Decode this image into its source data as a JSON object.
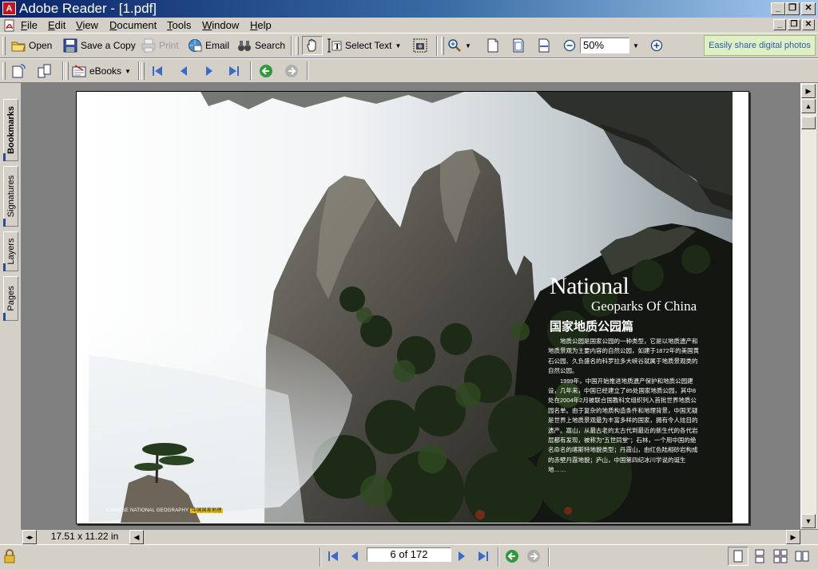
{
  "window": {
    "title": "Adobe Reader - [1.pdf]",
    "app_icon_glyph": "A"
  },
  "menu": [
    {
      "label": "File",
      "access": "F"
    },
    {
      "label": "Edit",
      "access": "E"
    },
    {
      "label": "View",
      "access": "V"
    },
    {
      "label": "Document",
      "access": "D"
    },
    {
      "label": "Tools",
      "access": "T"
    },
    {
      "label": "Window",
      "access": "W"
    },
    {
      "label": "Help",
      "access": "H"
    }
  ],
  "toolbar": {
    "open": "Open",
    "save_copy": "Save a Copy",
    "print": "Print",
    "email": "Email",
    "search": "Search",
    "select_text": "Select Text",
    "zoom": "50%",
    "promo": "Easily share digital photos",
    "ebooks": "eBooks"
  },
  "nav_tabs": [
    "Bookmarks",
    "Signatures",
    "Layers",
    "Pages"
  ],
  "document": {
    "title_en_1": "National",
    "title_en_2": "Geoparks Of China",
    "title_cn": "国家地质公园篇",
    "paragraphs": [
      "　　地质公园是国家公园的一种类型，它是以地质遗产和地质景观为主要内容的自然公园，如建于1872年的美国黄石公园、久负盛名的科罗拉多大峡谷就属于地质景观类的自然公园。",
      "　　1999年，中国开始推进地质遗产保护和地质公园建设，几年来，中国已经建立了85处国家地质公园，其中8处在2004年2月被联合国教科文组织列入首批世界地质公园名单。由于复杂的地质构造条件和地理背景，中国无疑是世界上地质景观最为丰富多样的国家，拥有令人炫目的遗产。嵩山，从最古老的太古代到最近的新生代的各代岩层都有发现，被称为\"五世同堂\"；石林，一个用中国的绝名命名的喀斯特地貌类型；丹霞山，由红色陆相砂岩构成的赤壁丹霞地貌；庐山，中国第四纪冰川学说的诞生地……"
    ],
    "brand": "CHINESE NATIONAL GEOGRAPHY",
    "brand_tag": "中国国家地理"
  },
  "status": {
    "page_size": "17.51 x 11.22 in",
    "page_indicator": "6 of 172"
  },
  "colors": {
    "titlebar": "#0a246a",
    "chrome": "#d4d0c8",
    "doc_bg": "#808080"
  }
}
